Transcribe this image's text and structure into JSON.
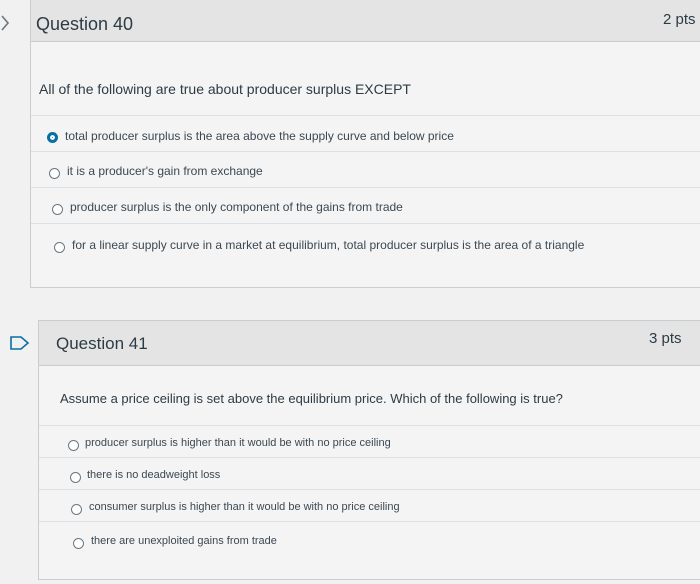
{
  "q40": {
    "title": "Question 40",
    "points": "2 pts",
    "text": "All of the following are true about producer surplus EXCEPT",
    "answers": [
      {
        "label": "total producer surplus is the area above the supply curve and below price",
        "selected": true
      },
      {
        "label": "it is a producer's gain from exchange",
        "selected": false
      },
      {
        "label": "producer surplus is the only component of the gains from trade",
        "selected": false
      },
      {
        "label": "for a linear supply curve in a market at equilibrium, total producer surplus is the area of a triangle",
        "selected": false
      }
    ]
  },
  "q41": {
    "title": "Question 41",
    "points": "3 pts",
    "text": "Assume a price ceiling is set above the equilibrium price. Which of the following is true?",
    "answers": [
      {
        "label": "producer surplus is higher than it would be with no price ceiling",
        "selected": false
      },
      {
        "label": "there is no deadweight loss",
        "selected": false
      },
      {
        "label": "consumer surplus is higher than it would be with no price ceiling",
        "selected": false
      },
      {
        "label": "there are unexploited gains from trade",
        "selected": false
      }
    ]
  },
  "colors": {
    "accent": "#0770a3",
    "flag": "#0770a3"
  }
}
